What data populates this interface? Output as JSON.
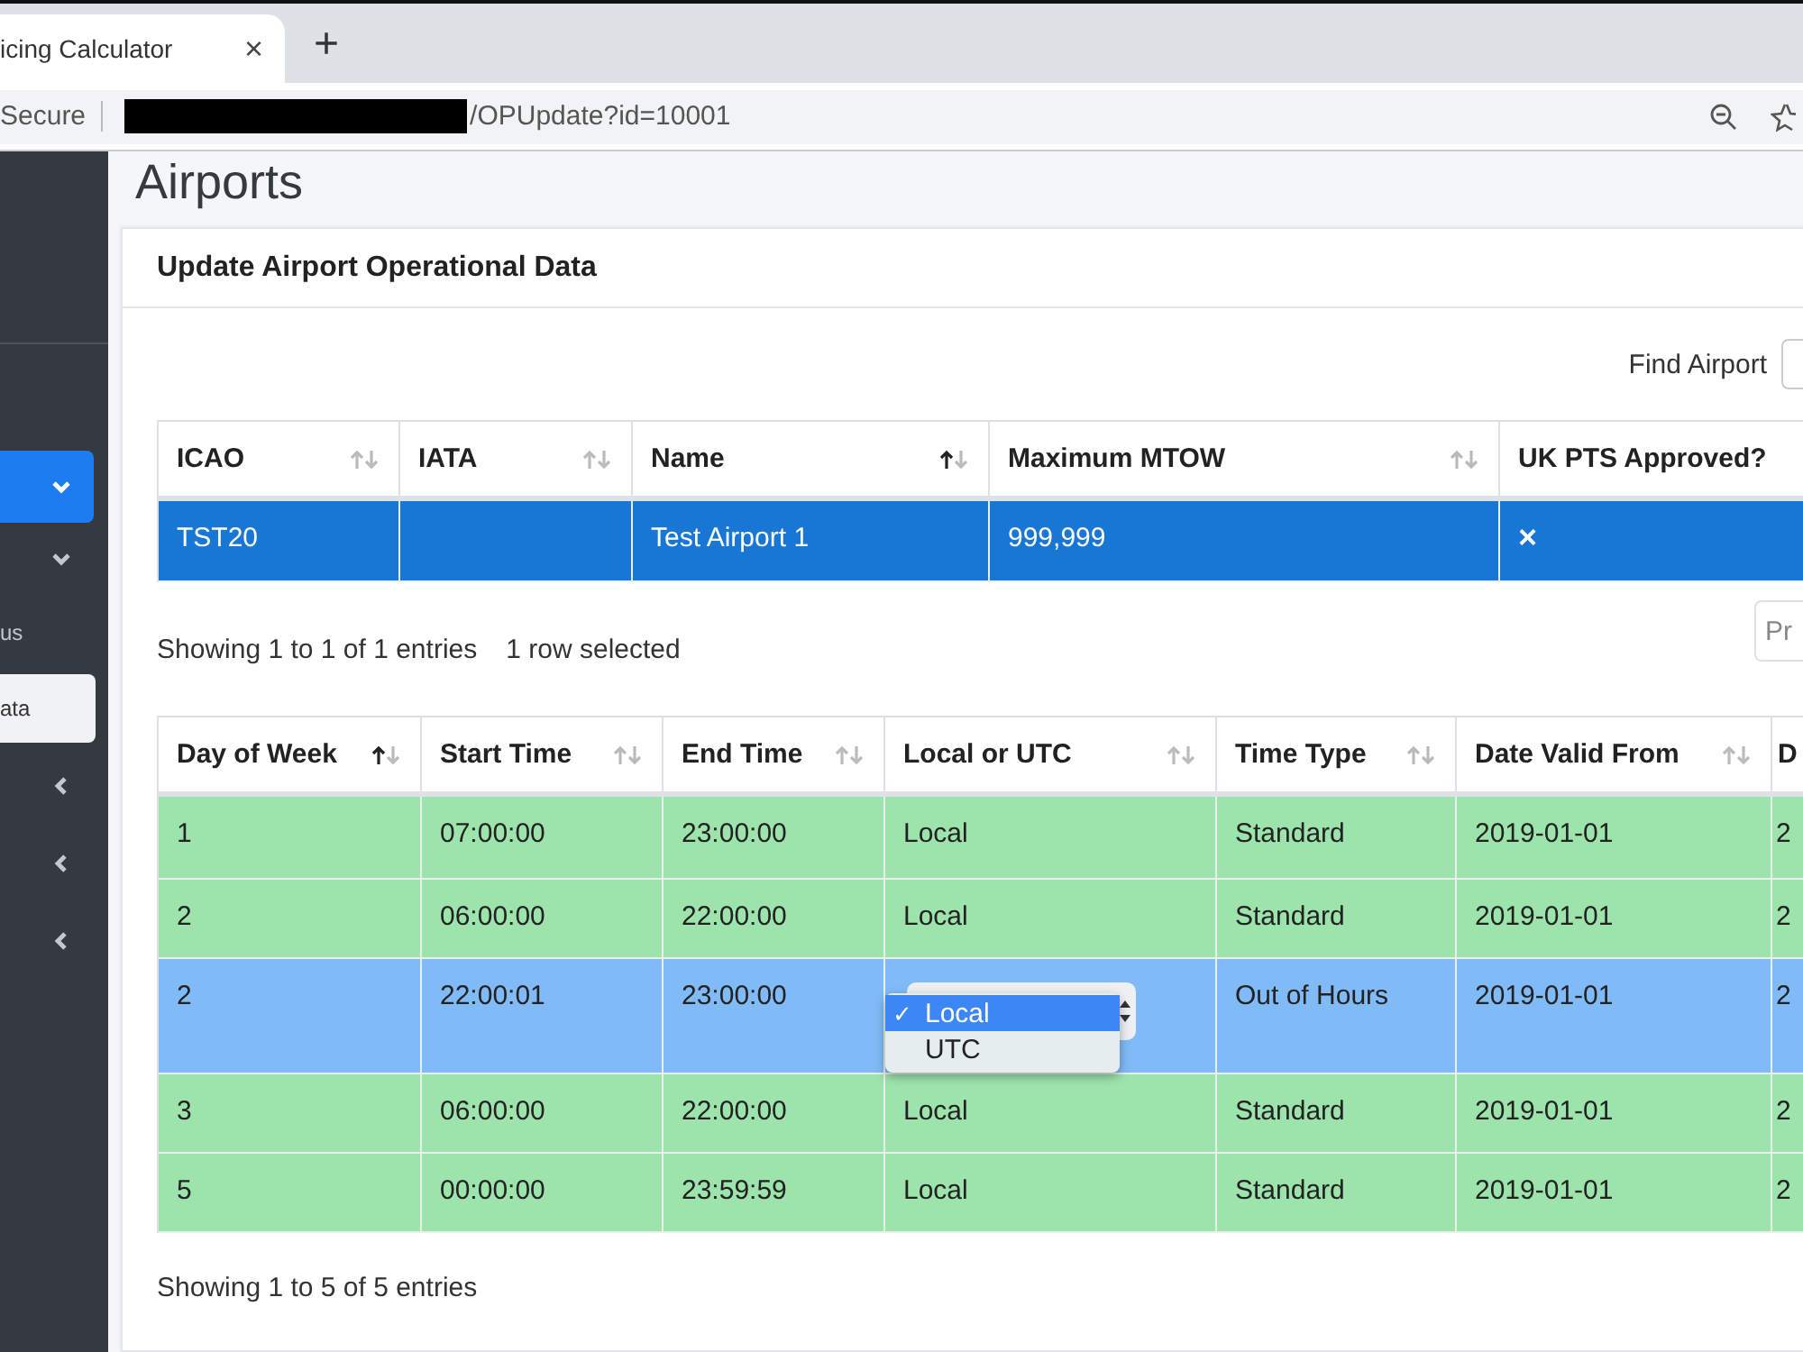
{
  "browser": {
    "tab_title": "icing Calculator",
    "tab_close": "×",
    "new_tab": "+",
    "security": "Secure",
    "url": "/OPUpdate?id=10001"
  },
  "sidebar": {
    "items": [
      {
        "kind": "group",
        "expanded": true,
        "active": true
      },
      {
        "kind": "group",
        "expanded": true,
        "active": false
      },
      {
        "kind": "link",
        "label": "us",
        "selected": false
      },
      {
        "kind": "link",
        "label": "ata",
        "selected": true
      },
      {
        "kind": "group",
        "expanded": false,
        "active": false
      },
      {
        "kind": "group",
        "expanded": false,
        "active": false
      },
      {
        "kind": "group",
        "expanded": false,
        "active": false
      }
    ]
  },
  "page_title": "Airports",
  "card_title": "Update Airport Operational Data",
  "search": {
    "label": "Find Airport"
  },
  "airports": {
    "columns": [
      {
        "label": "ICAO",
        "sortable": true,
        "sorted_ascending": false
      },
      {
        "label": "IATA",
        "sortable": true,
        "sorted_ascending": false
      },
      {
        "label": "Name",
        "sortable": true,
        "sorted_ascending": true
      },
      {
        "label": "Maximum MTOW",
        "sortable": true,
        "sorted_ascending": false
      },
      {
        "label": "UK PTS Approved?",
        "sortable": false
      }
    ],
    "rows": [
      {
        "selected": true,
        "cells": [
          "TST20",
          "",
          "Test Airport 1",
          "999,999",
          "×"
        ]
      }
    ],
    "info": "Showing 1 to 1 of 1 entries",
    "selection_info": "1 row selected",
    "pager_button": "Pr"
  },
  "hours": {
    "columns": [
      {
        "label": "Day of Week",
        "sortable": true,
        "sorted_ascending": true
      },
      {
        "label": "Start Time",
        "sortable": true,
        "sorted_ascending": false
      },
      {
        "label": "End Time",
        "sortable": true,
        "sorted_ascending": false
      },
      {
        "label": "Local or UTC",
        "sortable": true,
        "sorted_ascending": false
      },
      {
        "label": "Time Type",
        "sortable": true,
        "sorted_ascending": false
      },
      {
        "label": "Date Valid From",
        "sortable": true,
        "sorted_ascending": false
      },
      {
        "label": "D",
        "sortable": false
      }
    ],
    "rows": [
      {
        "selected": false,
        "cells": [
          "1",
          "07:00:00",
          "23:00:00",
          "Local",
          "Standard",
          "2019-01-01",
          "2"
        ]
      },
      {
        "selected": false,
        "cells": [
          "2",
          "06:00:00",
          "22:00:00",
          "Local",
          "Standard",
          "2019-01-01",
          "2"
        ]
      },
      {
        "selected": true,
        "cells": [
          "2",
          "22:00:01",
          "23:00:00",
          {
            "kind": "select",
            "check": "✓",
            "options": [
              {
                "label": "Local",
                "selected": true
              },
              {
                "label": "UTC",
                "selected": false
              }
            ]
          },
          "Out of Hours",
          "2019-01-01",
          "2"
        ]
      },
      {
        "selected": false,
        "cells": [
          "3",
          "06:00:00",
          "22:00:00",
          "Local",
          "Standard",
          "2019-01-01",
          "2"
        ]
      },
      {
        "selected": false,
        "cells": [
          "5",
          "00:00:00",
          "23:59:59",
          "Local",
          "Standard",
          "2019-01-01",
          "2"
        ]
      }
    ],
    "info": "Showing 1 to 5 of 5 entries"
  }
}
